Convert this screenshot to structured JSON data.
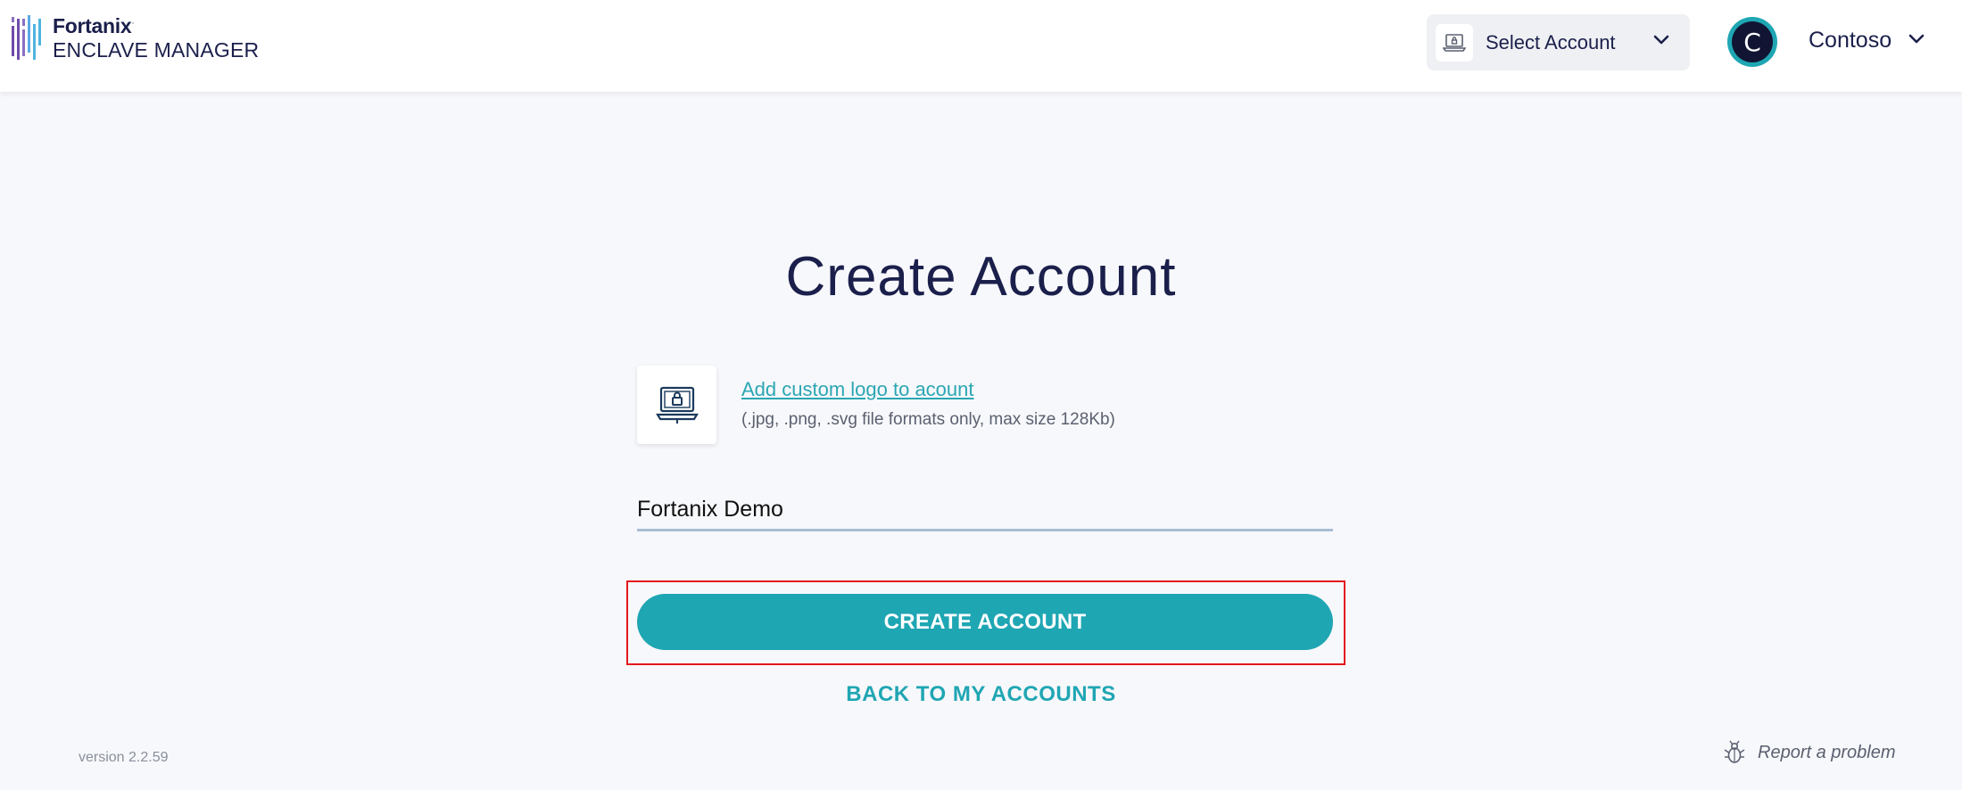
{
  "header": {
    "logo_brand": "Fortanix",
    "logo_product": "ENCLAVE MANAGER",
    "account_select_label": "Select Account",
    "account_select_icon": "laptop-lock-icon",
    "user_initial": "C",
    "user_name": "Contoso"
  },
  "main": {
    "title": "Create Account",
    "upload_link": "Add custom logo to acount",
    "upload_hint": "(.jpg, .png, .svg file formats only, max size 128Kb)",
    "account_name_value": "Fortanix Demo",
    "create_button": "CREATE ACCOUNT",
    "back_link": "BACK TO MY ACCOUNTS"
  },
  "footer": {
    "version": "version 2.2.59",
    "report_label": "Report a problem",
    "report_icon": "bug-icon"
  },
  "colors": {
    "accent": "#1fa6b3",
    "navy": "#1b1f4b",
    "highlight": "#e3171e",
    "background": "#f7f8fb"
  }
}
